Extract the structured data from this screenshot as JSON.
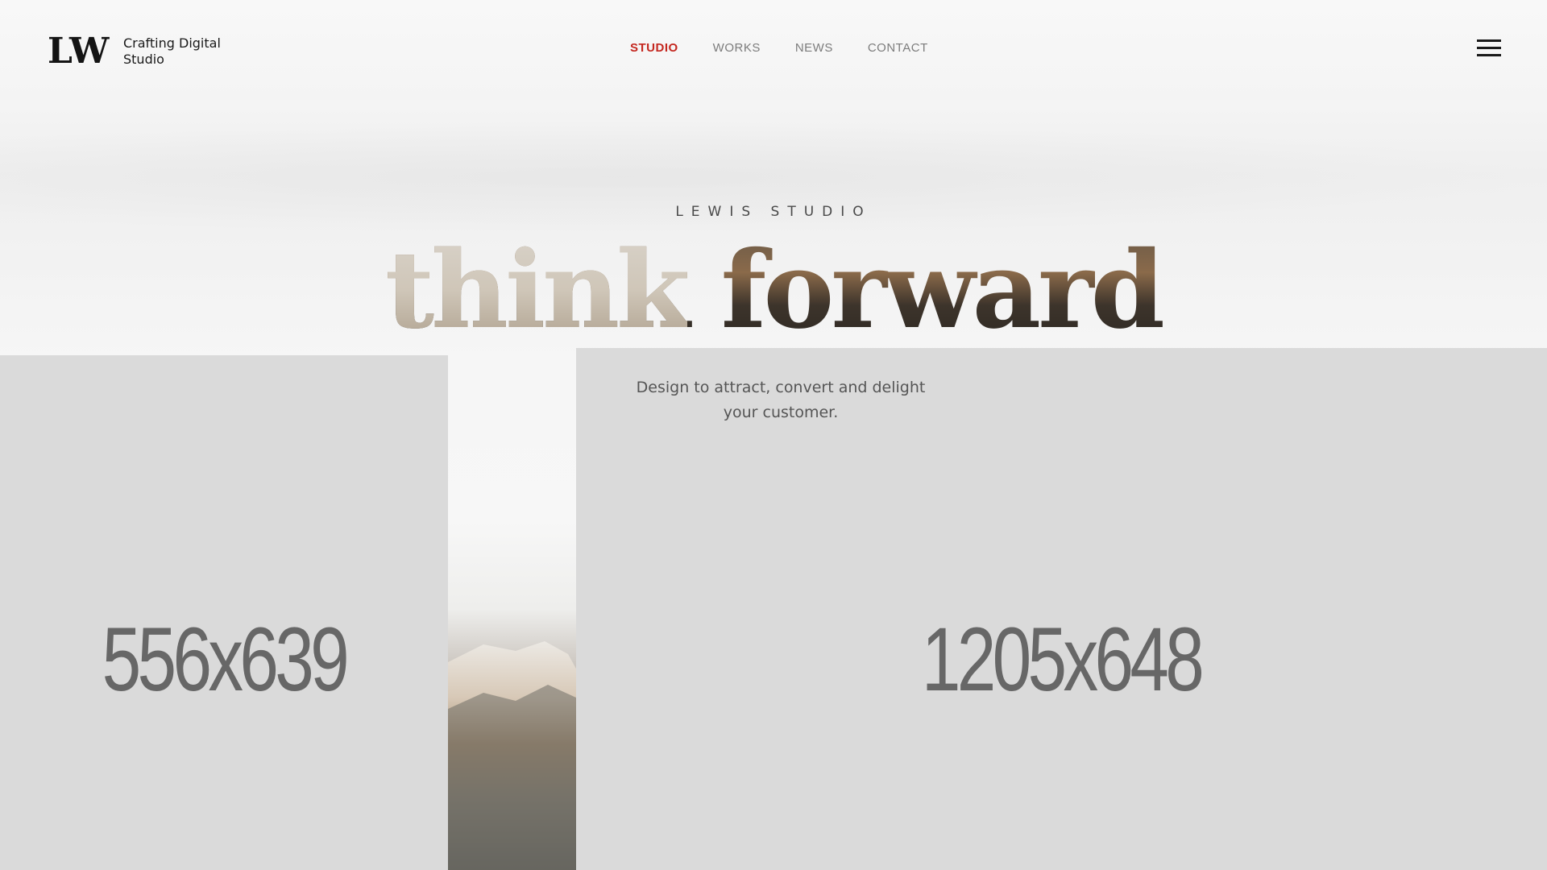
{
  "brand": {
    "logo": "LW",
    "tagline": "Crafting Digital Studio"
  },
  "nav": {
    "items": [
      {
        "label": "STUDIO",
        "active": true
      },
      {
        "label": "WORKS",
        "active": false
      },
      {
        "label": "NEWS",
        "active": false
      },
      {
        "label": "CONTACT",
        "active": false
      }
    ],
    "menu_icon": "hamburger-menu-icon"
  },
  "hero": {
    "eyebrow": "LEWIS STUDIO",
    "headline_part1": "think",
    "headline_part2": "forward",
    "subtitle": "Design to attract, convert and delight your customer."
  },
  "placeholders": {
    "left_label": "556x639",
    "right_label": "1205x648"
  },
  "colors": {
    "accent": "#c4271f",
    "placeholder_bg": "#dadada",
    "placeholder_text": "#676767",
    "nav_text": "#7c7c7c"
  }
}
